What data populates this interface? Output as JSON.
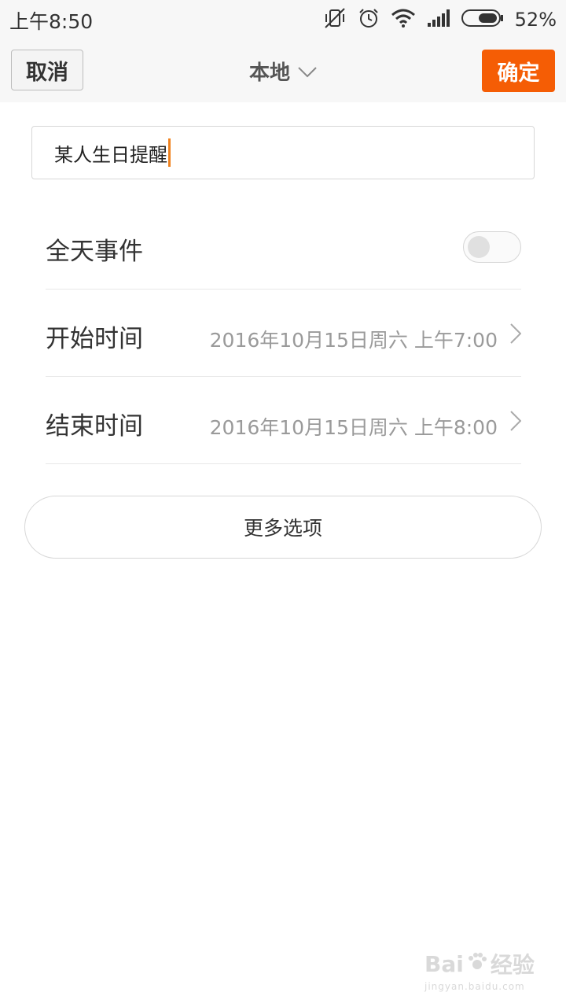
{
  "status_bar": {
    "time": "上午8:50",
    "battery_percent": "52%",
    "icons": [
      "vibrate-off-icon",
      "alarm-icon",
      "wifi-icon",
      "signal-icon",
      "battery-icon"
    ]
  },
  "title_bar": {
    "cancel_label": "取消",
    "calendar_label": "本地",
    "confirm_label": "确定"
  },
  "event": {
    "title_value": "某人生日提醒"
  },
  "rows": {
    "all_day_label": "全天事件",
    "all_day_on": false,
    "start_label": "开始时间",
    "start_value": "2016年10月15日周六 上午7:00",
    "end_label": "结束时间",
    "end_value": "2016年10月15日周六 上午8:00"
  },
  "more_options_label": "更多选项",
  "watermark": {
    "brand": "Bai",
    "brand_suffix": "经验",
    "url": "jingyan.baidu.com"
  },
  "colors": {
    "accent": "#f55d05",
    "caret": "#f0821e"
  }
}
